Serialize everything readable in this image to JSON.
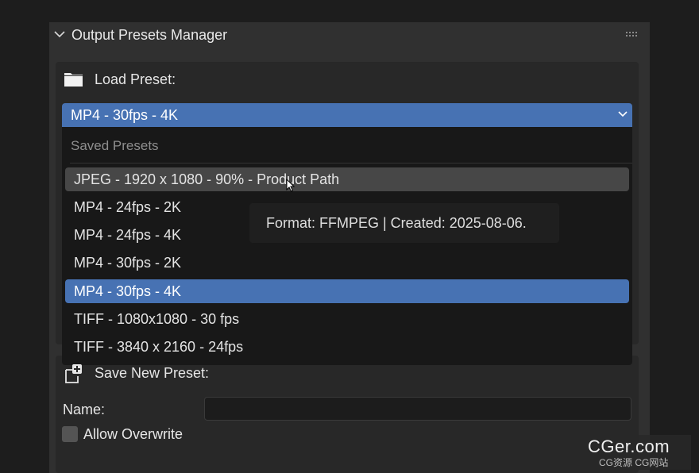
{
  "panel": {
    "title": "Output Presets Manager",
    "icons": {
      "collapse": "chevron-down-icon",
      "drag": "drag-grip-icon"
    }
  },
  "load": {
    "label": "Load Preset:",
    "icon": "folder-icon",
    "selected_value": "MP4 - 30fps - 4K",
    "dropdown_icon": "chevron-down-icon"
  },
  "dropdown": {
    "heading": "Saved Presets",
    "items": [
      {
        "label": "JPEG - 1920 x 1080 - 90% - Product Path",
        "state": "hover"
      },
      {
        "label": "MP4 - 24fps - 2K",
        "state": "normal"
      },
      {
        "label": "MP4 - 24fps - 4K",
        "state": "normal"
      },
      {
        "label": "MP4 - 30fps - 2K",
        "state": "normal"
      },
      {
        "label": "MP4 - 30fps - 4K",
        "state": "selected"
      },
      {
        "label": "TIFF - 1080x1080 - 30 fps",
        "state": "normal"
      },
      {
        "label": "TIFF - 3840 x 2160 - 24fps",
        "state": "normal"
      }
    ]
  },
  "tooltip": {
    "text": "Format: FFMPEG | Created: 2025-08-06."
  },
  "save": {
    "label": "Save New Preset:",
    "icon": "new-file-plus-icon",
    "name_label": "Name:",
    "name_value": "",
    "overwrite_label": "Allow Overwrite",
    "overwrite_checked": false
  },
  "watermark": {
    "main": "CGer.com",
    "sub": "CG资源 CG网站"
  },
  "colors": {
    "accent": "#4772b3",
    "panel_bg": "#303030",
    "dropdown_bg": "#181818",
    "hover_bg": "#474747"
  }
}
